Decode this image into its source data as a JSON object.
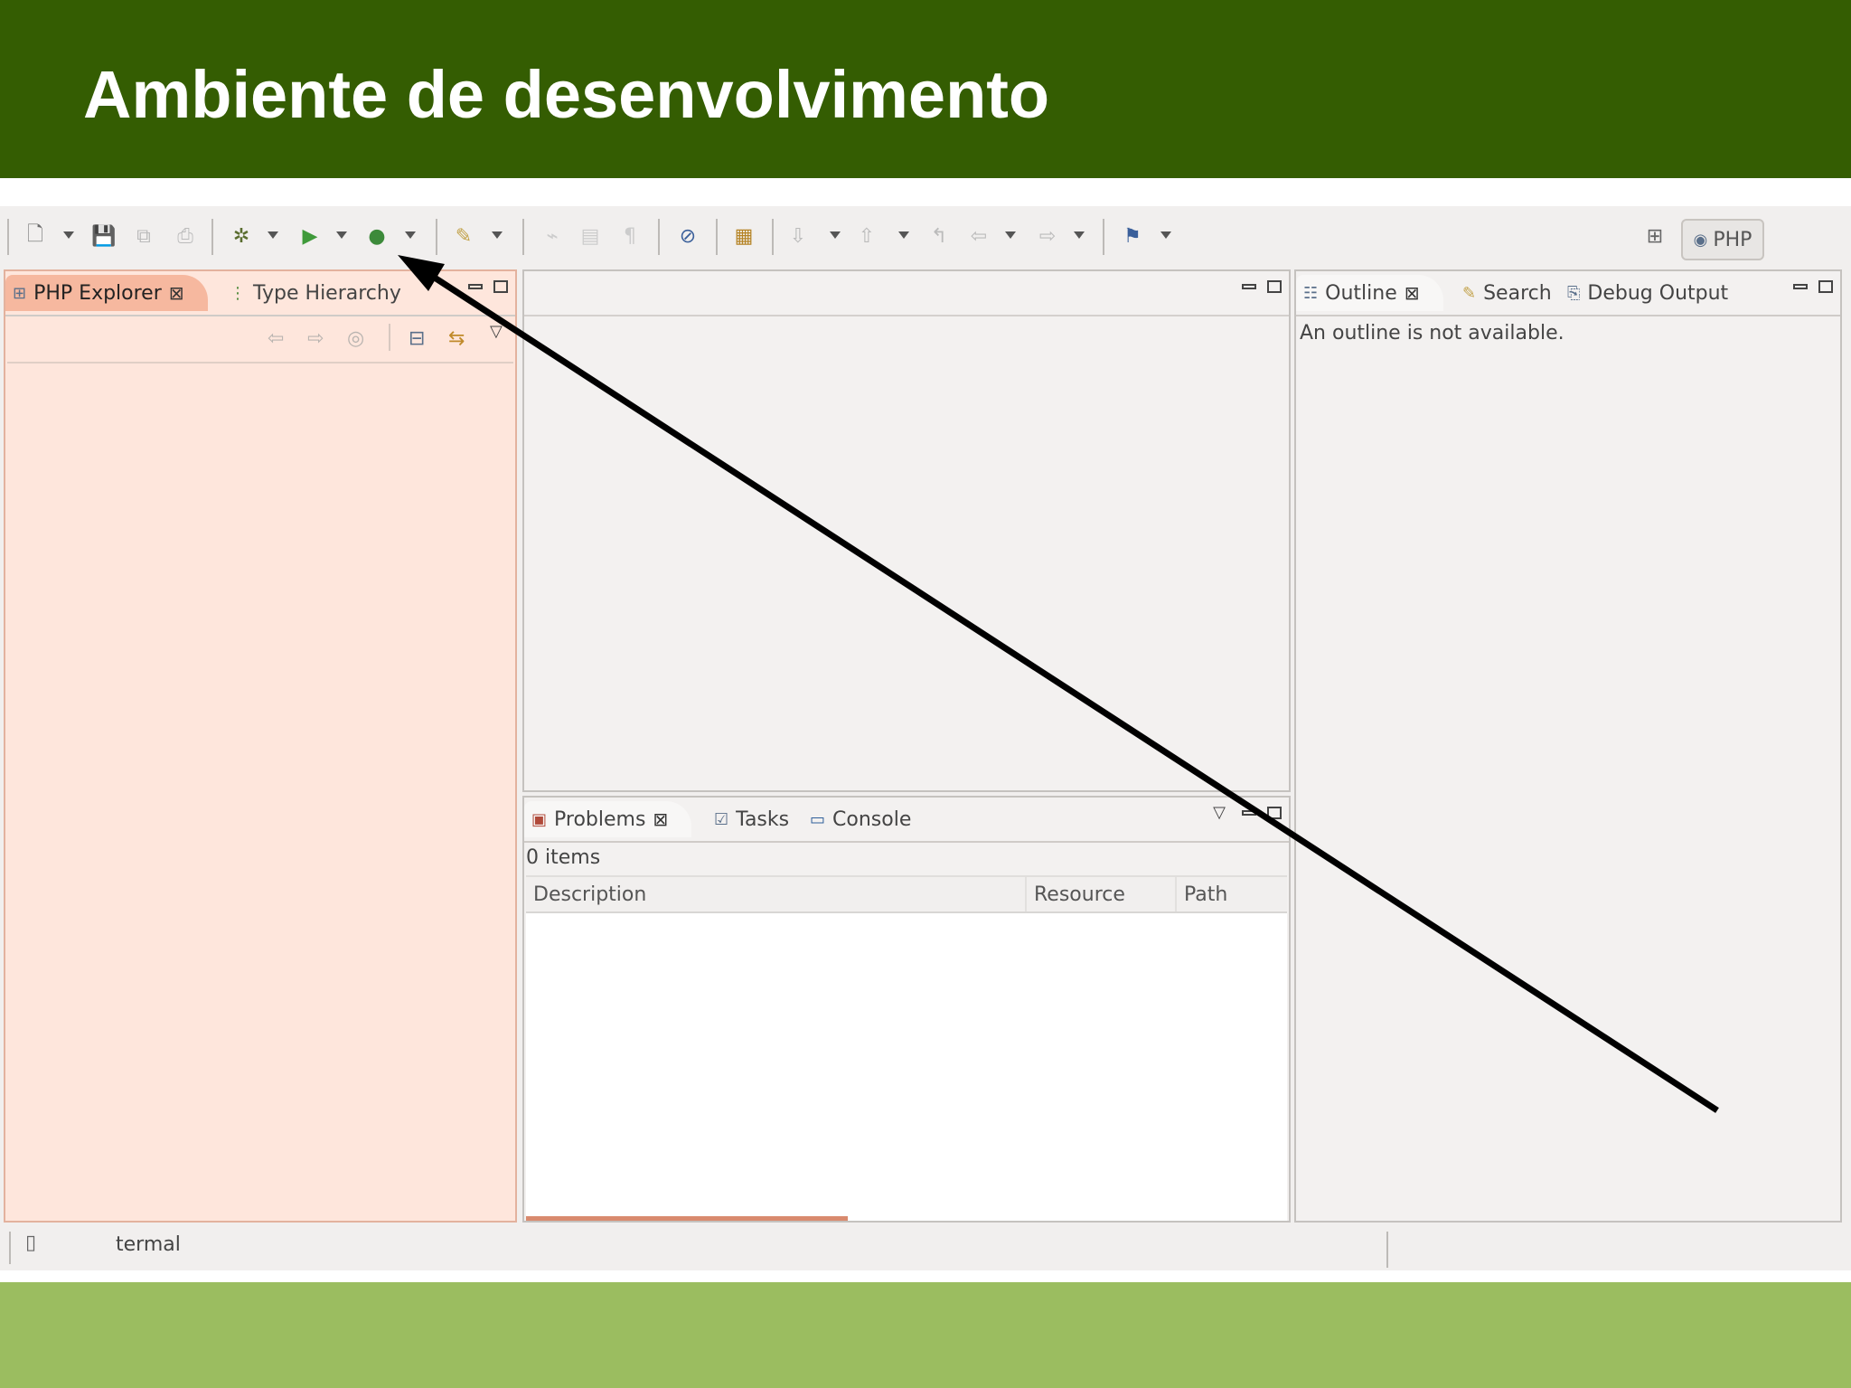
{
  "slide": {
    "title": "Ambiente de desenvolvimento"
  },
  "toolbar": {
    "icons": [
      "new-file-icon",
      "save-icon",
      "save-all-icon",
      "print-icon",
      "debug-icon",
      "run-icon",
      "run-external-icon",
      "open-type-icon",
      "toggle-mark-icon",
      "block-icon",
      "pilcrow-icon",
      "skip-breakpoints-icon",
      "build-icon",
      "next-annotation-icon",
      "prev-annotation-icon",
      "last-edit-icon",
      "back-icon",
      "forward-icon",
      "task-flag-icon"
    ],
    "perspective_label": "PHP"
  },
  "explorer": {
    "tabs": [
      {
        "label": "PHP Explorer",
        "active": true
      },
      {
        "label": "Type Hierarchy",
        "active": false
      }
    ]
  },
  "outline": {
    "tabs": [
      {
        "label": "Outline",
        "active": true
      },
      {
        "label": "Search",
        "active": false
      },
      {
        "label": "Debug Output",
        "active": false
      }
    ],
    "message": "An outline is not available."
  },
  "problems": {
    "tabs": [
      {
        "label": "Problems",
        "active": true
      },
      {
        "label": "Tasks",
        "active": false
      },
      {
        "label": "Console",
        "active": false
      }
    ],
    "count_text": "0 items",
    "columns": [
      "Description",
      "Resource",
      "Path"
    ]
  },
  "statusbar": {
    "text": "termal"
  },
  "colors": {
    "title_bg": "#345d02",
    "footer_bg": "#9bbd60",
    "explorer_bg": "#fee6dc",
    "explorer_tab": "#f6b89f"
  }
}
